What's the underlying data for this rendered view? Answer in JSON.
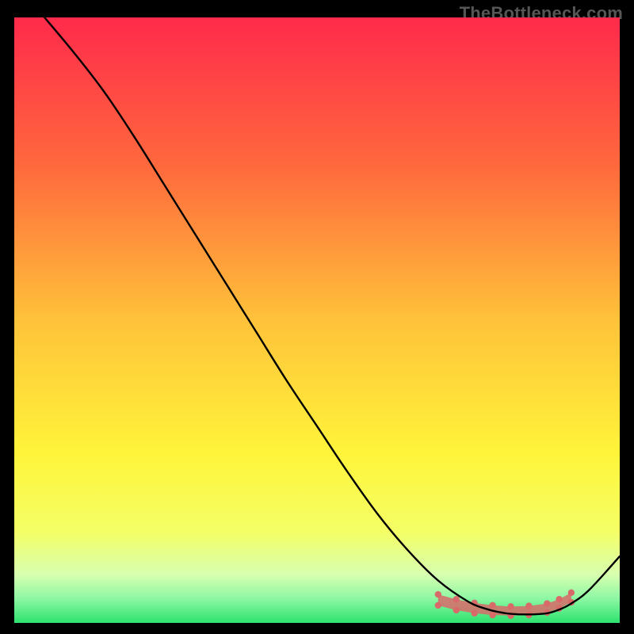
{
  "watermark": "TheBottleneck.com",
  "chart_data": {
    "type": "line",
    "title": "",
    "xlabel": "",
    "ylabel": "",
    "xlim": [
      0,
      100
    ],
    "ylim": [
      0,
      100
    ],
    "curve": {
      "x": [
        5,
        10,
        15,
        20,
        25,
        30,
        35,
        40,
        45,
        50,
        55,
        60,
        65,
        70,
        75,
        78,
        80,
        82,
        85,
        88,
        90,
        92,
        95,
        100
      ],
      "y": [
        100,
        94,
        87.5,
        80,
        72,
        64,
        56,
        48,
        40,
        32.5,
        25,
        18,
        12,
        7,
        3.5,
        2.3,
        1.8,
        1.5,
        1.4,
        1.6,
        2.2,
        3.2,
        5.5,
        11
      ]
    },
    "confidence_band": {
      "x": [
        70,
        73,
        76,
        79,
        82,
        85,
        88,
        90,
        92
      ],
      "upper": [
        4.7,
        3.9,
        3.3,
        2.9,
        2.7,
        2.8,
        3.2,
        3.9,
        5.0
      ],
      "lower": [
        2.9,
        2.1,
        1.6,
        1.3,
        1.2,
        1.3,
        1.7,
        2.4,
        3.4
      ]
    },
    "gradient_stops": [
      {
        "offset": 0.0,
        "color": "#ff2a4b"
      },
      {
        "offset": 0.25,
        "color": "#ff6a3d"
      },
      {
        "offset": 0.5,
        "color": "#ffc23a"
      },
      {
        "offset": 0.72,
        "color": "#fff43a"
      },
      {
        "offset": 0.85,
        "color": "#f4ff66"
      },
      {
        "offset": 0.92,
        "color": "#d8ffb0"
      },
      {
        "offset": 0.96,
        "color": "#8cf7a3"
      },
      {
        "offset": 1.0,
        "color": "#2de36f"
      }
    ],
    "curve_color": "#000000",
    "band_color": "#d86a6a"
  }
}
